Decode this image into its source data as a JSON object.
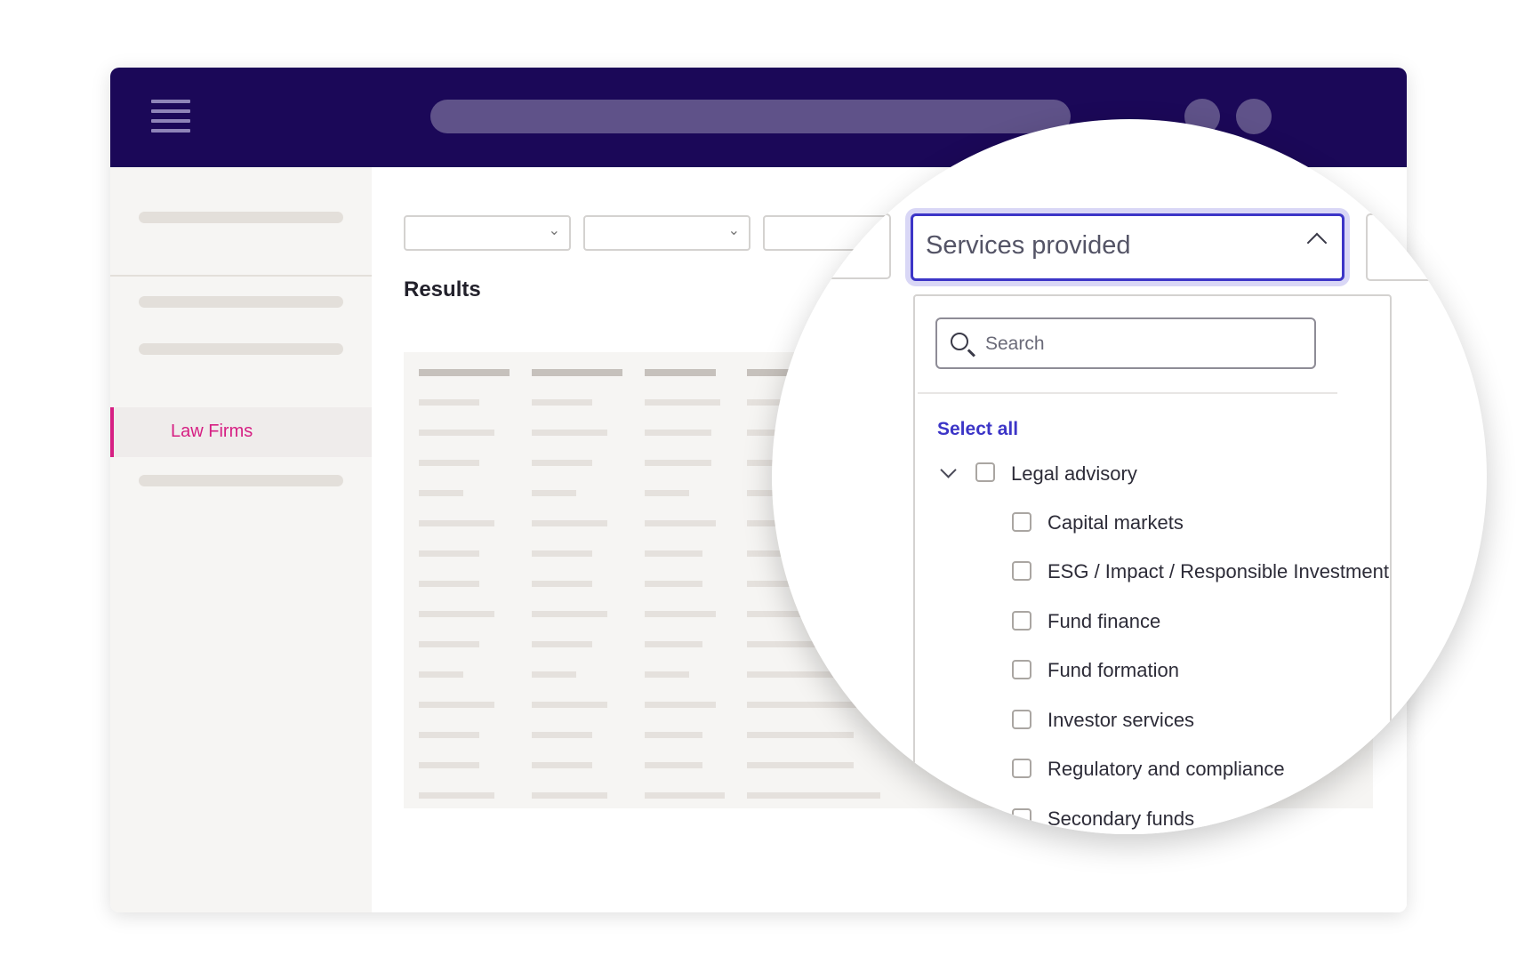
{
  "main": {
    "results_title": "Results"
  },
  "sidebar": {
    "active_item": "Law Firms"
  },
  "filter": {
    "label": "Services provided",
    "search_placeholder": "Search",
    "select_all": "Select all",
    "parent_option": "Legal advisory",
    "options": [
      "Capital markets",
      "ESG / Impact / Responsible Investment",
      "Fund finance",
      "Fund formation",
      "Investor services",
      "Regulatory and compliance",
      "Secondary funds"
    ]
  },
  "colors": {
    "topbar": "#1b0858",
    "accent_blue": "#3c35c7",
    "active_pink": "#d61f83",
    "sidebar_bg": "#f6f5f3"
  },
  "icons": [
    "menu-icon",
    "chevron-down-icon",
    "chevron-up-icon",
    "search-icon",
    "checkbox-icon"
  ]
}
